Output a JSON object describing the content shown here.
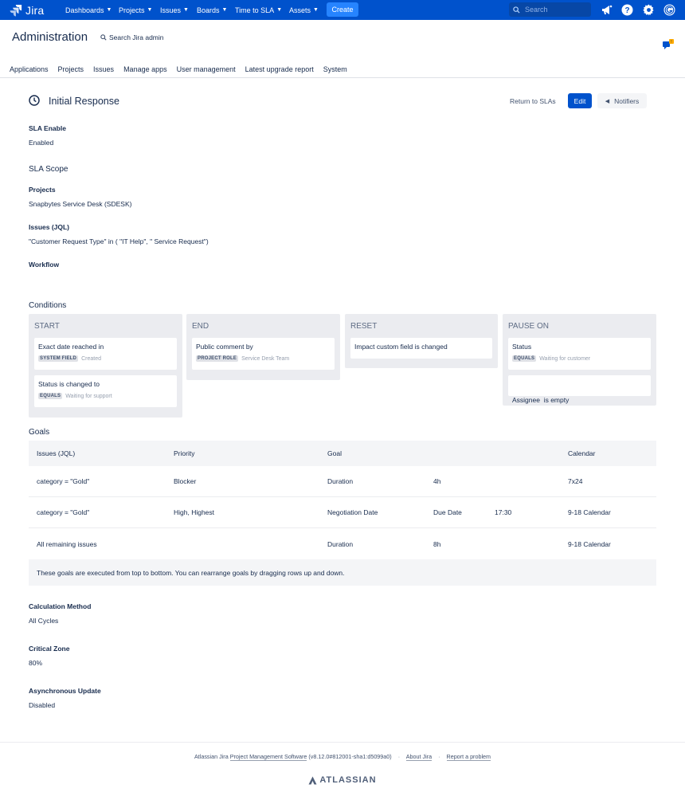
{
  "colors": {
    "nav_bg": "#0052cc",
    "primary_button": "#0052cc",
    "create_button": "#2684ff",
    "text": "#172b4d",
    "muted": "#5e6c84"
  },
  "topnav": {
    "logo_text": "Jira",
    "items": [
      {
        "label": "Dashboards",
        "icon": "chevron-down-icon"
      },
      {
        "label": "Projects",
        "icon": "chevron-down-icon"
      },
      {
        "label": "Issues",
        "icon": "chevron-down-icon"
      },
      {
        "label": "Boards",
        "icon": "chevron-down-icon"
      },
      {
        "label": "Time to SLA",
        "icon": "chevron-down-icon"
      },
      {
        "label": "Assets",
        "icon": "chevron-down-icon"
      }
    ],
    "create_label": "Create",
    "search_placeholder": "Search",
    "icons": [
      "announcement-icon",
      "help-icon",
      "settings-gear-icon",
      "user-avatar-icon"
    ]
  },
  "admin": {
    "title": "Administration",
    "search_link": "Search Jira admin",
    "tabs": [
      "Applications",
      "Projects",
      "Issues",
      "Manage apps",
      "User management",
      "Latest upgrade report",
      "System"
    ]
  },
  "page": {
    "title": "Initial Response",
    "return_label": "Return to SLAs",
    "edit_label": "Edit",
    "notifiers_label": "Notifiers"
  },
  "sla_enable": {
    "label": "SLA Enable",
    "value": "Enabled"
  },
  "sla_scope": {
    "title": "SLA Scope",
    "projects_label": "Projects",
    "projects_value": "Snapbytes Service Desk (SDESK)",
    "jql_label": "Issues (JQL)",
    "jql_value": "\"Customer Request Type\" in ( \"IT Help\", \" Service Request\")",
    "workflow_label": "Workflow"
  },
  "conditions": {
    "title": "Conditions",
    "columns": [
      {
        "title": "START",
        "cards": [
          {
            "text": "Exact date reached in",
            "tag": "SYSTEM FIELD",
            "value": "Created"
          },
          {
            "text": "Status is changed to",
            "tag": "EQUALS",
            "value": "Waiting for support"
          }
        ]
      },
      {
        "title": "END",
        "cards": [
          {
            "text": "Public comment by",
            "tag": "PROJECT ROLE",
            "value": "Service Desk Team"
          }
        ]
      },
      {
        "title": "RESET",
        "cards": [
          {
            "text": "Impact custom field is changed"
          }
        ]
      },
      {
        "title": "PAUSE ON",
        "cards": [
          {
            "text": "Status",
            "tag": "EQUALS",
            "value": "Waiting for customer"
          },
          {
            "text": "Assignee  is empty"
          }
        ]
      }
    ]
  },
  "goals": {
    "title": "Goals",
    "headers": {
      "jql": "Issues (JQL)",
      "priority": "Priority",
      "goal": "Goal",
      "calendar": "Calendar"
    },
    "rows": [
      {
        "jql": "category = \"Gold\"",
        "priority": "Blocker",
        "goal_type": "Duration",
        "goal_value": "4h",
        "goal_time": "",
        "calendar": "7x24"
      },
      {
        "jql": "category = \"Gold\"",
        "priority": "High, Highest",
        "goal_type": "Negotiation Date",
        "goal_value": "Due Date",
        "goal_time": "17:30",
        "calendar": "9-18 Calendar"
      },
      {
        "jql": "All remaining issues",
        "priority": "",
        "goal_type": "Duration",
        "goal_value": "8h",
        "goal_time": "",
        "calendar": "9-18 Calendar"
      }
    ],
    "note": "These goals are executed from top to bottom. You can rearrange goals by dragging rows up and down."
  },
  "calculation": {
    "label": "Calculation Method",
    "value": "All Cycles"
  },
  "critical_zone": {
    "label": "Critical Zone",
    "value": "80%"
  },
  "async_update": {
    "label": "Asynchronous Update",
    "value": "Disabled"
  },
  "footer": {
    "software_text": "Atlassian Jira",
    "software_link": "Project Management Software",
    "version": "(v8.12.0#812001-sha1:d5099a0)",
    "about": "About Jira",
    "report": "Report a problem",
    "brand": "ATLASSIAN"
  }
}
